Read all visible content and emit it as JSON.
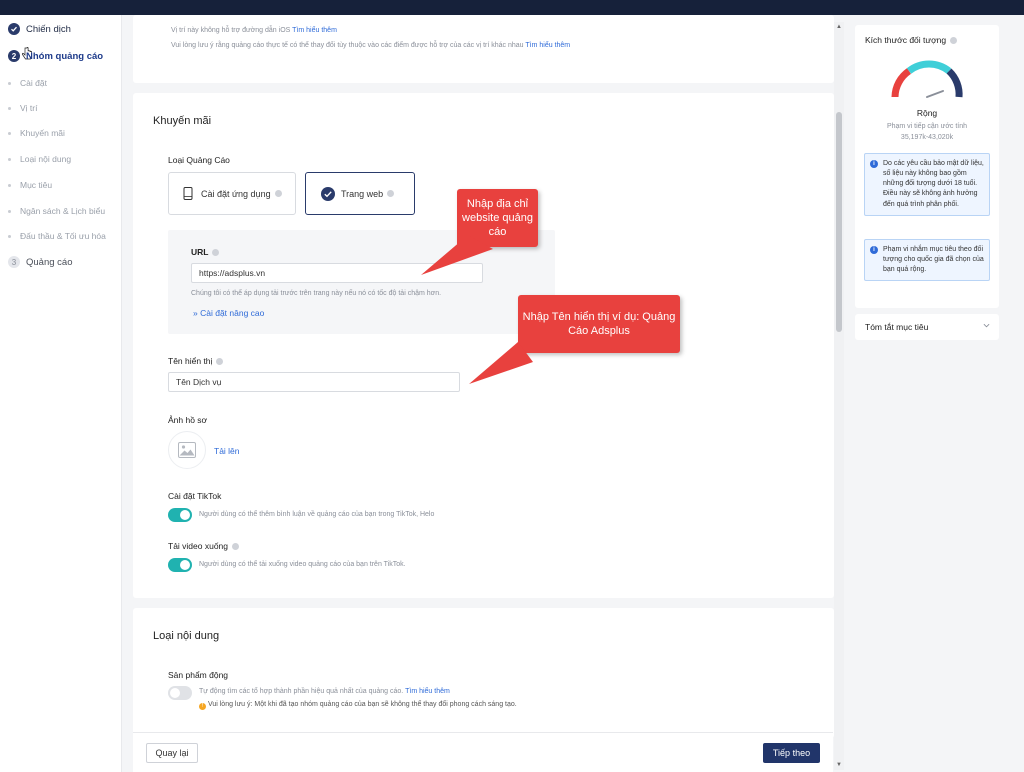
{
  "sidebar": {
    "steps": [
      {
        "number": "",
        "label": "Chiến dịch",
        "state": "done"
      },
      {
        "number": "2",
        "label": "Nhóm quảng cáo",
        "state": "active"
      },
      {
        "number": "3",
        "label": "Quảng cáo",
        "state": "todo"
      }
    ],
    "subitems": [
      "Cài đặt",
      "Vị trí",
      "Khuyến mãi",
      "Loại nội dung",
      "Mục tiêu",
      "Ngân sách & Lịch biểu",
      "Đấu thầu & Tối ưu hóa"
    ]
  },
  "placement": {
    "note1_text": "Vị trí này không hỗ trợ đường dẫn iOS",
    "note1_link": "Tìm hiểu thêm",
    "note2_text": "Vui lòng lưu ý rằng quảng cáo thực tế có thể thay đổi tùy thuộc vào các điểm được hỗ trợ của các vị trí khác nhau",
    "note2_link": "Tìm hiểu thêm"
  },
  "promo": {
    "title": "Khuyến mãi",
    "ad_type_label": "Loại Quảng Cáo",
    "option_app": "Cài đặt ứng dụng",
    "option_web": "Trang web",
    "url_label": "URL",
    "url_value": "https://adsplus.vn",
    "url_hint": "Chúng tôi có thể áp dụng tải trước trên trang này nếu nó có tốc độ tải chậm hơn.",
    "advanced_link": "Cài đặt nâng cao",
    "display_name_label": "Tên hiển thị",
    "display_name_value": "Tên Dịch vụ",
    "profile_image_label": "Ảnh hồ sơ",
    "upload_link": "Tải lên",
    "tiktok_settings_label": "Cài đặt TikTok",
    "tiktok_settings_desc": "Người dùng có thể thêm bình luận về quảng cáo của bạn trong TikTok, Helo",
    "download_label": "Tải video xuống",
    "download_desc": "Người dùng có thể tải xuống video quảng cáo của bạn trên TikTok."
  },
  "content_type": {
    "title": "Loại nội dung",
    "dynamic_label": "Sản phẩm động",
    "dynamic_desc": "Tự động tìm các tổ hợp thành phần hiệu quả nhất của quảng cáo.",
    "dynamic_link": "Tìm hiểu thêm",
    "warning": "Vui lòng lưu ý: Một khi đã tạo nhóm quảng cáo của bạn sẽ không thể thay đổi phong cách sáng tạo."
  },
  "callouts": {
    "url": "Nhập địa chỉ website quảng cáo",
    "name": "Nhập Tên hiển thị ví dụ: Quảng Cáo Adsplus"
  },
  "footer": {
    "back_label": "Quay lại",
    "next_label": "Tiếp theo"
  },
  "audience": {
    "title": "Kích thước đối tượng",
    "gauge_value": "Rộng",
    "reach_label": "Phạm vi tiếp cận ước tính",
    "reach_value": "35,197k-43,020k",
    "info1": "Do các yêu cầu bảo mật dữ liệu, số liệu này không bao gồm những đối tượng dưới 18 tuổi. Điều này sẽ không ảnh hưởng đến quá trình phân phối.",
    "info2": "Phạm vi nhắm mục tiêu theo đối tượng cho quốc gia đã chọn của bạn quá rộng.",
    "summary_label": "Tóm tắt mục tiêu"
  },
  "colors": {
    "accent": "#21356a",
    "toggle": "#20b2b0",
    "callout": "#e8413e",
    "link": "#2f6bd8"
  }
}
